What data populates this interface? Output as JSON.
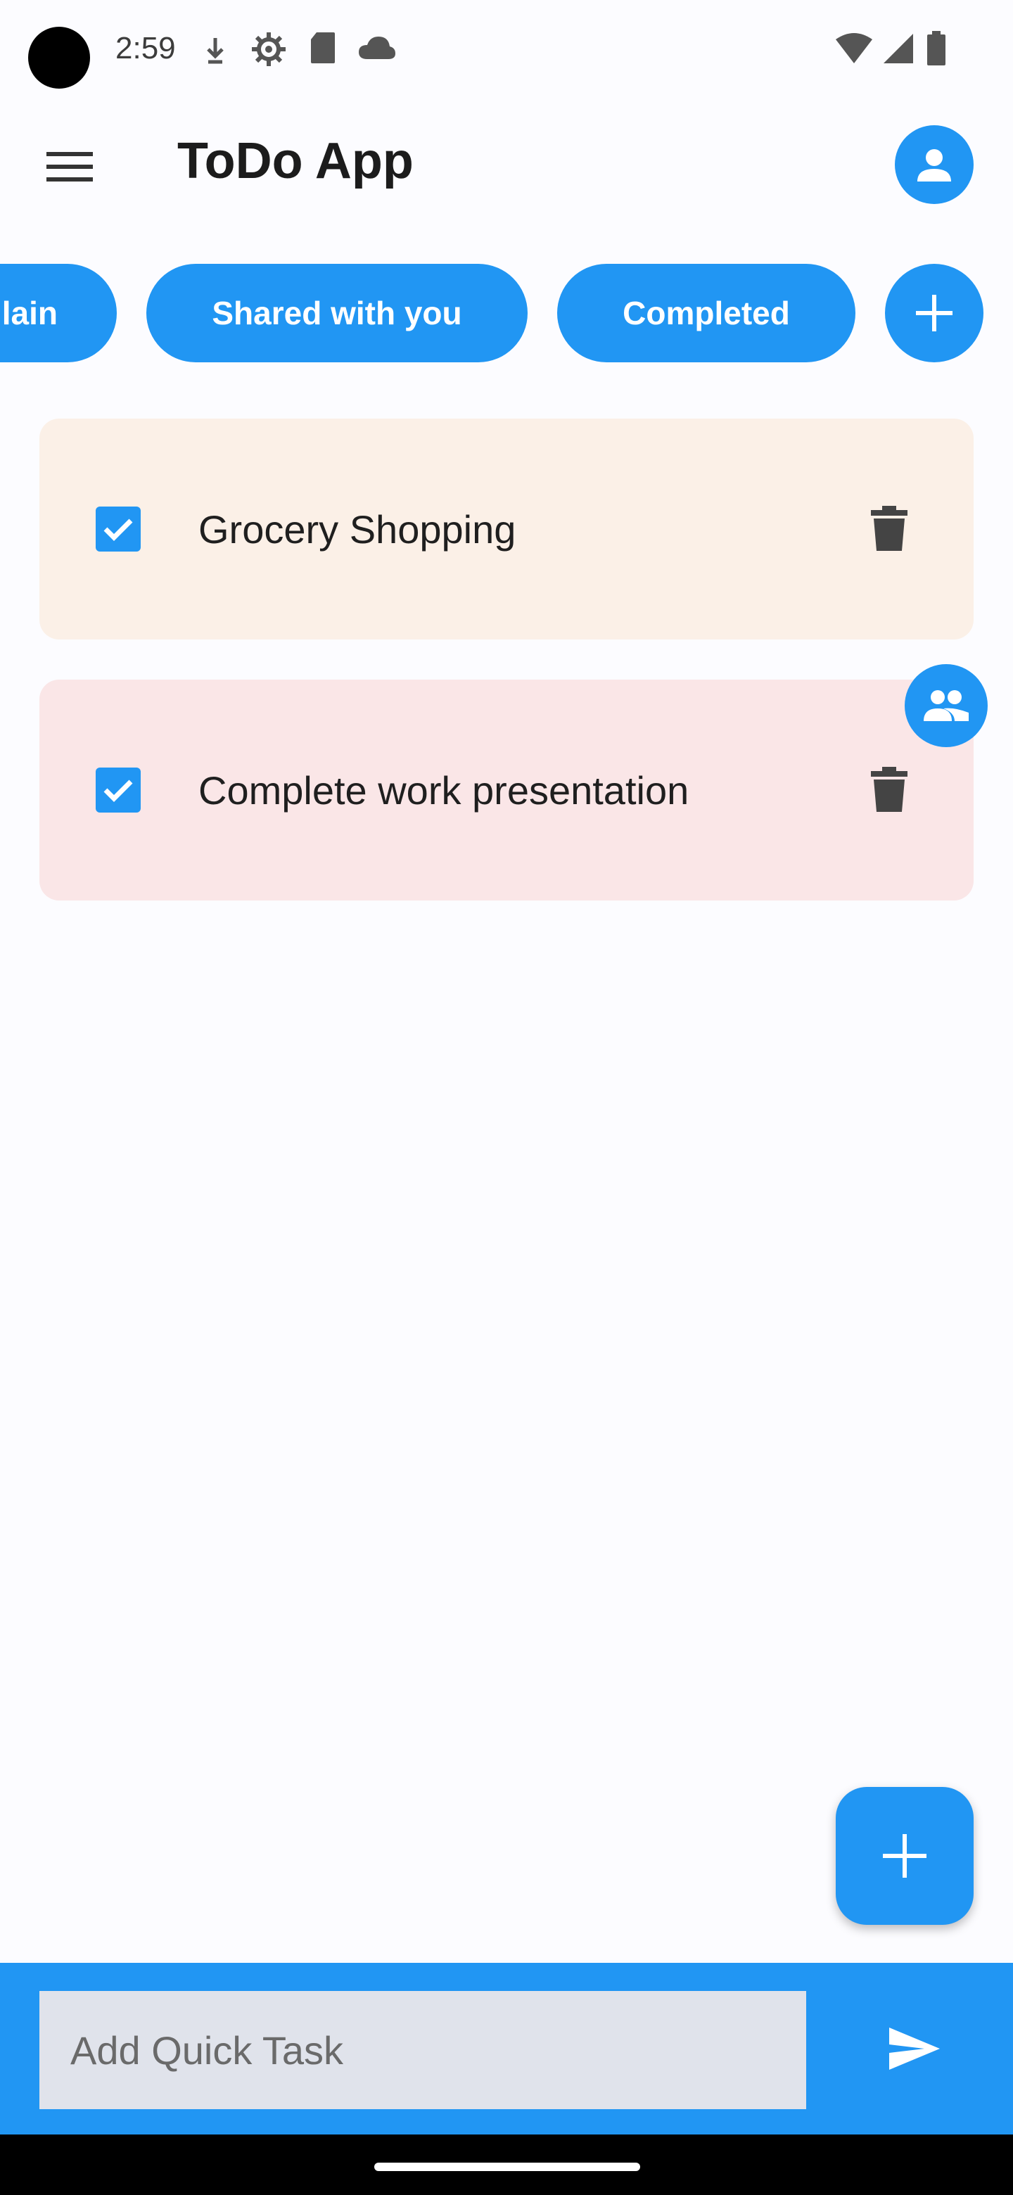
{
  "status_bar": {
    "time": "2:59",
    "left_icons": [
      "download-status-icon",
      "settings-status-icon",
      "sd-card-icon",
      "cloud-icon"
    ],
    "right_icons": [
      "wifi-icon",
      "cellular-signal-icon",
      "battery-icon"
    ]
  },
  "app_bar": {
    "title": "ToDo App",
    "menu_icon": "menu-icon",
    "profile_icon": "person-icon"
  },
  "tabs": [
    {
      "label": "Main",
      "visible_text": "lain"
    },
    {
      "label": "Shared with you"
    },
    {
      "label": "Completed"
    }
  ],
  "tasks": [
    {
      "title": "Grocery Shopping",
      "checked": true,
      "background": "#fbf0e7",
      "shared": false
    },
    {
      "title": "Complete work presentation",
      "checked": true,
      "background": "#fae6e7",
      "shared": true
    }
  ],
  "quick_add": {
    "placeholder": "Add Quick Task",
    "value": ""
  },
  "colors": {
    "accent": "#2196f3",
    "background": "#fcfcff",
    "input_background": "#e0e3eb"
  }
}
